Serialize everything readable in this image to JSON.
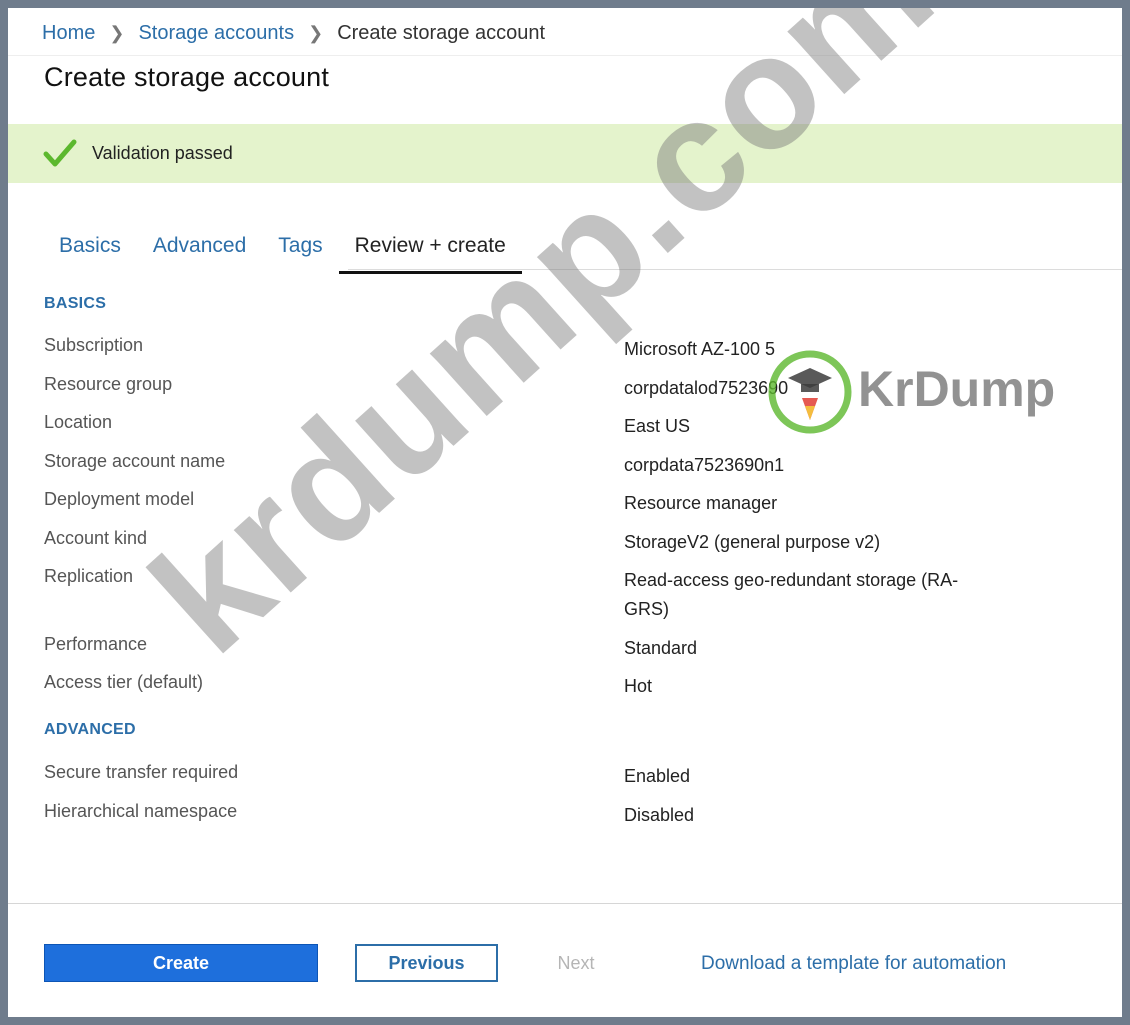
{
  "breadcrumb": [
    {
      "label": "Home",
      "link": true
    },
    {
      "label": "Storage accounts",
      "link": true
    },
    {
      "label": "Create storage account",
      "link": false
    }
  ],
  "page_title": "Create storage account",
  "validation": {
    "message": "Validation passed",
    "icon": "checkmark-icon",
    "color": "#5cb82e",
    "background": "#e4f3cc"
  },
  "tabs": [
    {
      "label": "Basics"
    },
    {
      "label": "Advanced"
    },
    {
      "label": "Tags"
    },
    {
      "label": "Review + create",
      "active": true
    }
  ],
  "basics": {
    "heading": "BASICS",
    "rows": [
      {
        "label": "Subscription",
        "value": "Microsoft AZ-100 5"
      },
      {
        "label": "Resource group",
        "value": "corpdatalod7523690"
      },
      {
        "label": "Location",
        "value": "East US"
      },
      {
        "label": "Storage account name",
        "value": "corpdata7523690n1"
      },
      {
        "label": "Deployment model",
        "value": "Resource manager"
      },
      {
        "label": "Account kind",
        "value": "StorageV2 (general purpose v2)"
      },
      {
        "label": "Replication",
        "value": "Read-access geo-redundant storage (RA-GRS)"
      },
      {
        "label": "Performance",
        "value": "Standard"
      },
      {
        "label": "Access tier (default)",
        "value": "Hot"
      }
    ]
  },
  "advanced": {
    "heading": "ADVANCED",
    "rows": [
      {
        "label": "Secure transfer required",
        "value": "Enabled"
      },
      {
        "label": "Hierarchical namespace",
        "value": "Disabled"
      }
    ]
  },
  "footer": {
    "create_label": "Create",
    "previous_label": "Previous",
    "next_label": "Next",
    "download_label": "Download a template for automation"
  },
  "watermark": {
    "text": "krdump.com",
    "brand": "KrDump"
  },
  "colors": {
    "accent": "#2c6ea8",
    "primary_button": "#1e6fdc",
    "page_background": "#6f7c8c"
  }
}
